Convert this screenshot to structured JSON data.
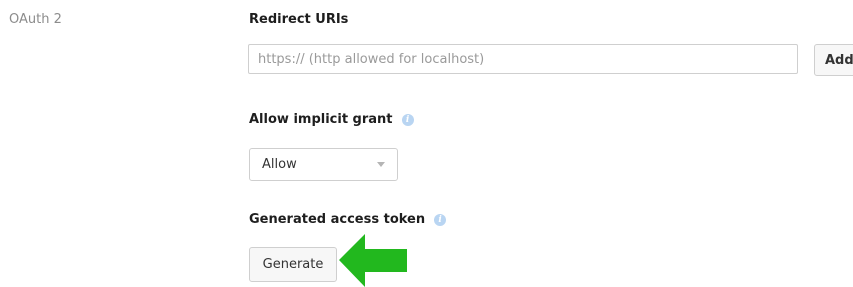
{
  "section": {
    "label": "OAuth 2"
  },
  "redirect_uris": {
    "heading": "Redirect URIs",
    "input_value": "",
    "input_placeholder": "https:// (http allowed for localhost)",
    "add_label": "Add"
  },
  "implicit_grant": {
    "heading": "Allow implicit grant",
    "info_icon": "info-icon",
    "selected_value": "Allow"
  },
  "access_token": {
    "heading": "Generated access token",
    "info_icon": "info-icon",
    "generate_label": "Generate"
  },
  "colors": {
    "arrow": "#22b81e",
    "info_icon": "#b9d5f2"
  }
}
